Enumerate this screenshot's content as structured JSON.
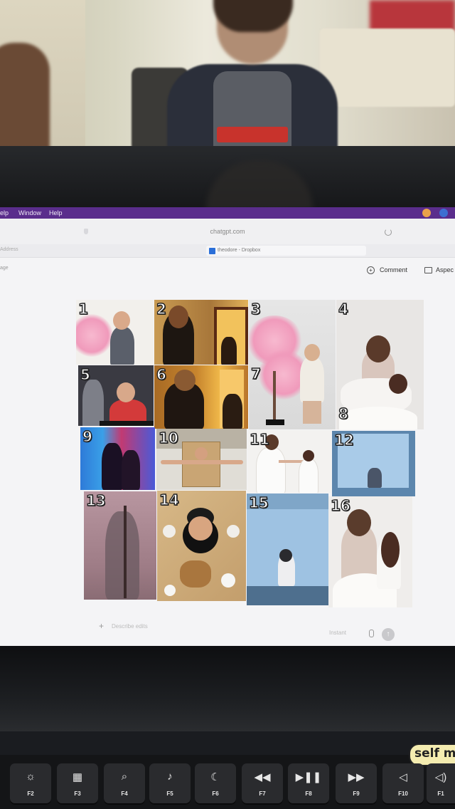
{
  "menubar": {
    "items": [
      "elp",
      "Window",
      "Help"
    ]
  },
  "browser": {
    "url": "chatgpt.com",
    "tab_left": "Address",
    "active_tab": "theodore - Dropbox",
    "page_left_label": "age",
    "comment_label": "Comment",
    "aspect_label": "Aspec"
  },
  "grid_numbers": [
    "1",
    "2",
    "3",
    "4",
    "5",
    "6",
    "7",
    "8",
    "9",
    "10",
    "11",
    "12",
    "13",
    "14",
    "15",
    "16"
  ],
  "composer": {
    "placeholder": "Describe edits",
    "model": "Instant",
    "send_symbol": "↑"
  },
  "sticker": {
    "text": "self m"
  },
  "keys": [
    {
      "sym": "☼",
      "fn": "F2",
      "icon": "brightness-up-icon"
    },
    {
      "sym": "▦",
      "fn": "F3",
      "icon": "mission-control-icon"
    },
    {
      "sym": "⌕",
      "fn": "F4",
      "icon": "search-icon"
    },
    {
      "sym": "♪",
      "fn": "F5",
      "icon": "dictation-icon"
    },
    {
      "sym": "☾",
      "fn": "F6",
      "icon": "do-not-disturb-icon"
    },
    {
      "sym": "◀◀",
      "fn": "F7",
      "icon": "rewind-icon"
    },
    {
      "sym": "▶❚❚",
      "fn": "F8",
      "icon": "play-pause-icon"
    },
    {
      "sym": "▶▶",
      "fn": "F9",
      "icon": "fast-forward-icon"
    },
    {
      "sym": "◁",
      "fn": "F10",
      "icon": "mute-icon"
    },
    {
      "sym": "◁)",
      "fn": "F1",
      "icon": "volume-icon"
    }
  ]
}
